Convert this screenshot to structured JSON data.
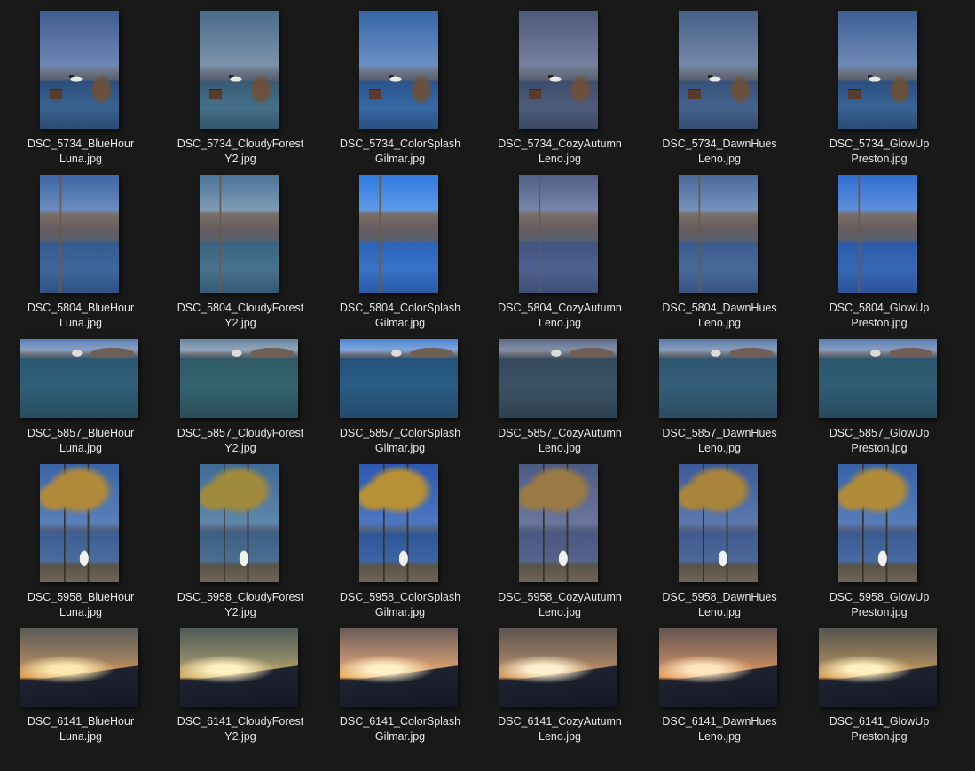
{
  "gallery": {
    "rows": [
      {
        "id": "DSC_5734",
        "items": [
          {
            "line1": "DSC_5734_BlueHour",
            "line2": "Luna.jpg"
          },
          {
            "line1": "DSC_5734_CloudyForest",
            "line2": "Y2.jpg"
          },
          {
            "line1": "DSC_5734_ColorSplash",
            "line2": "Gilmar.jpg"
          },
          {
            "line1": "DSC_5734_CozyAutumn",
            "line2": "Leno.jpg"
          },
          {
            "line1": "DSC_5734_DawnHues",
            "line2": "Leno.jpg"
          },
          {
            "line1": "DSC_5734_GlowUp",
            "line2": "Preston.jpg"
          }
        ]
      },
      {
        "id": "DSC_5804",
        "items": [
          {
            "line1": "DSC_5804_BlueHour",
            "line2": "Luna.jpg"
          },
          {
            "line1": "DSC_5804_CloudyForest",
            "line2": "Y2.jpg"
          },
          {
            "line1": "DSC_5804_ColorSplash",
            "line2": "Gilmar.jpg"
          },
          {
            "line1": "DSC_5804_CozyAutumn",
            "line2": "Leno.jpg"
          },
          {
            "line1": "DSC_5804_DawnHues",
            "line2": "Leno.jpg"
          },
          {
            "line1": "DSC_5804_GlowUp",
            "line2": "Preston.jpg"
          }
        ]
      },
      {
        "id": "DSC_5857",
        "items": [
          {
            "line1": "DSC_5857_BlueHour",
            "line2": "Luna.jpg"
          },
          {
            "line1": "DSC_5857_CloudyForest",
            "line2": "Y2.jpg"
          },
          {
            "line1": "DSC_5857_ColorSplash",
            "line2": "Gilmar.jpg"
          },
          {
            "line1": "DSC_5857_CozyAutumn",
            "line2": "Leno.jpg"
          },
          {
            "line1": "DSC_5857_DawnHues",
            "line2": "Leno.jpg"
          },
          {
            "line1": "DSC_5857_GlowUp",
            "line2": "Preston.jpg"
          }
        ]
      },
      {
        "id": "DSC_5958",
        "items": [
          {
            "line1": "DSC_5958_BlueHour",
            "line2": "Luna.jpg"
          },
          {
            "line1": "DSC_5958_CloudyForest",
            "line2": "Y2.jpg"
          },
          {
            "line1": "DSC_5958_ColorSplash",
            "line2": "Gilmar.jpg"
          },
          {
            "line1": "DSC_5958_CozyAutumn",
            "line2": "Leno.jpg"
          },
          {
            "line1": "DSC_5958_DawnHues",
            "line2": "Leno.jpg"
          },
          {
            "line1": "DSC_5958_GlowUp",
            "line2": "Preston.jpg"
          }
        ]
      },
      {
        "id": "DSC_6141",
        "items": [
          {
            "line1": "DSC_6141_BlueHour",
            "line2": "Luna.jpg"
          },
          {
            "line1": "DSC_6141_CloudyForest",
            "line2": "Y2.jpg"
          },
          {
            "line1": "DSC_6141_ColorSplash",
            "line2": "Gilmar.jpg"
          },
          {
            "line1": "DSC_6141_CozyAutumn",
            "line2": "Leno.jpg"
          },
          {
            "line1": "DSC_6141_DawnHues",
            "line2": "Leno.jpg"
          },
          {
            "line1": "DSC_6141_GlowUp",
            "line2": "Preston.jpg"
          }
        ]
      }
    ]
  },
  "colors": {
    "background": "#191919",
    "label_text": "#e6e6e6"
  }
}
